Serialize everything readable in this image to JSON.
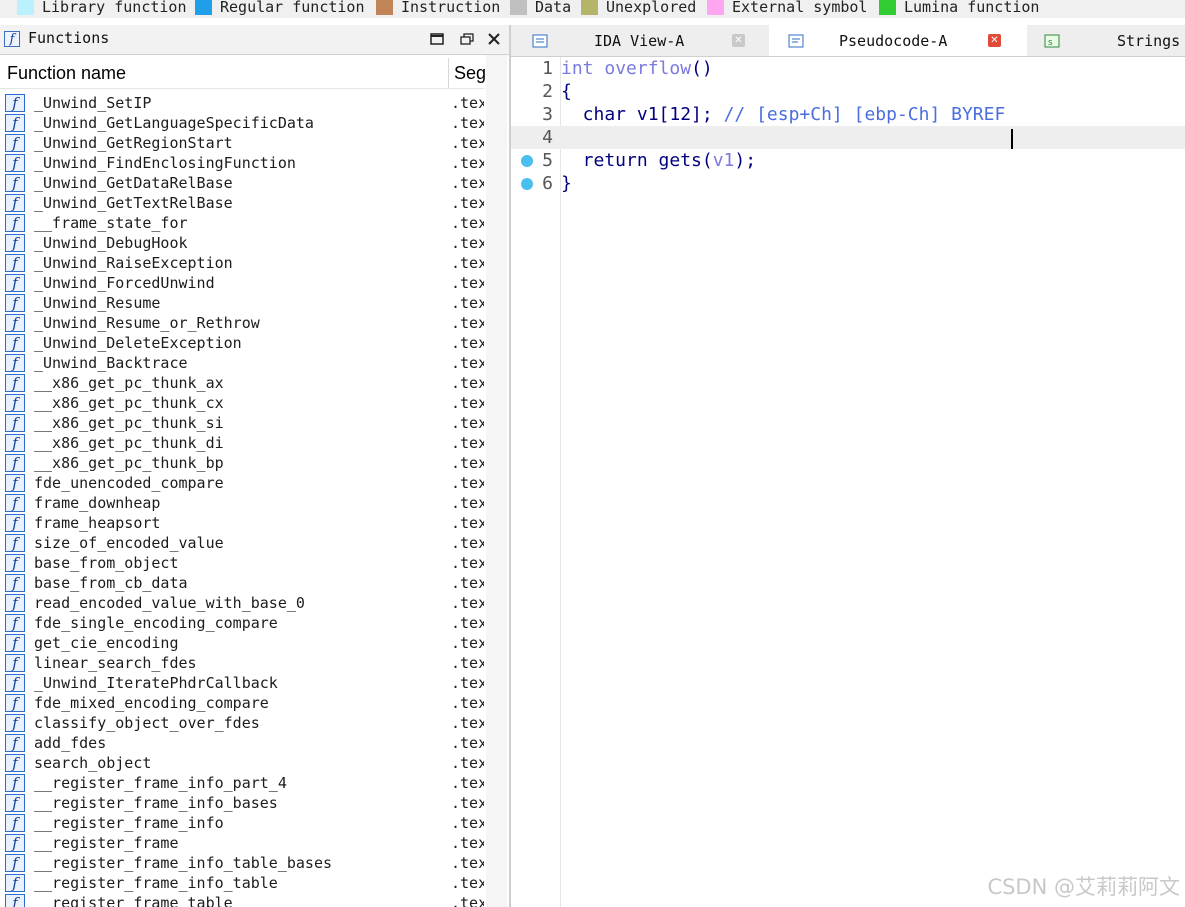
{
  "legend": [
    {
      "label": "Library function",
      "color": "#b9f1ff"
    },
    {
      "label": "Regular function",
      "color": "#1e9fe8"
    },
    {
      "label": "Instruction",
      "color": "#c08458"
    },
    {
      "label": "Data",
      "color": "#c0c0c0"
    },
    {
      "label": "Unexplored",
      "color": "#b5b56a"
    },
    {
      "label": "External symbol",
      "color": "#ffa6f0"
    },
    {
      "label": "Lumina function",
      "color": "#33cc33"
    }
  ],
  "functions_panel": {
    "title": "Functions",
    "col_name": "Function name",
    "col_segment": "Seg",
    "rows": [
      {
        "name": "_Unwind_SetIP",
        "seg": ".tex"
      },
      {
        "name": "_Unwind_GetLanguageSpecificData",
        "seg": ".tex"
      },
      {
        "name": "_Unwind_GetRegionStart",
        "seg": ".tex"
      },
      {
        "name": "_Unwind_FindEnclosingFunction",
        "seg": ".tex"
      },
      {
        "name": "_Unwind_GetDataRelBase",
        "seg": ".tex"
      },
      {
        "name": "_Unwind_GetTextRelBase",
        "seg": ".tex"
      },
      {
        "name": "__frame_state_for",
        "seg": ".tex"
      },
      {
        "name": "_Unwind_DebugHook",
        "seg": ".tex"
      },
      {
        "name": "_Unwind_RaiseException",
        "seg": ".tex"
      },
      {
        "name": "_Unwind_ForcedUnwind",
        "seg": ".tex"
      },
      {
        "name": "_Unwind_Resume",
        "seg": ".tex"
      },
      {
        "name": "_Unwind_Resume_or_Rethrow",
        "seg": ".tex"
      },
      {
        "name": "_Unwind_DeleteException",
        "seg": ".tex"
      },
      {
        "name": "_Unwind_Backtrace",
        "seg": ".tex"
      },
      {
        "name": "__x86_get_pc_thunk_ax",
        "seg": ".tex"
      },
      {
        "name": "__x86_get_pc_thunk_cx",
        "seg": ".tex"
      },
      {
        "name": "__x86_get_pc_thunk_si",
        "seg": ".tex"
      },
      {
        "name": "__x86_get_pc_thunk_di",
        "seg": ".tex"
      },
      {
        "name": "__x86_get_pc_thunk_bp",
        "seg": ".tex"
      },
      {
        "name": "fde_unencoded_compare",
        "seg": ".tex"
      },
      {
        "name": "frame_downheap",
        "seg": ".tex"
      },
      {
        "name": "frame_heapsort",
        "seg": ".tex"
      },
      {
        "name": "size_of_encoded_value",
        "seg": ".tex"
      },
      {
        "name": "base_from_object",
        "seg": ".tex"
      },
      {
        "name": "base_from_cb_data",
        "seg": ".tex"
      },
      {
        "name": "read_encoded_value_with_base_0",
        "seg": ".tex"
      },
      {
        "name": "fde_single_encoding_compare",
        "seg": ".tex"
      },
      {
        "name": "get_cie_encoding",
        "seg": ".tex"
      },
      {
        "name": "linear_search_fdes",
        "seg": ".tex"
      },
      {
        "name": "_Unwind_IteratePhdrCallback",
        "seg": ".tex"
      },
      {
        "name": "fde_mixed_encoding_compare",
        "seg": ".tex"
      },
      {
        "name": "classify_object_over_fdes",
        "seg": ".tex"
      },
      {
        "name": "add_fdes",
        "seg": ".tex"
      },
      {
        "name": "search_object",
        "seg": ".tex"
      },
      {
        "name": "__register_frame_info_part_4",
        "seg": ".tex"
      },
      {
        "name": "__register_frame_info_bases",
        "seg": ".tex"
      },
      {
        "name": "__register_frame_info",
        "seg": ".tex"
      },
      {
        "name": "__register_frame",
        "seg": ".tex"
      },
      {
        "name": "__register_frame_info_table_bases",
        "seg": ".tex"
      },
      {
        "name": "__register_frame_info_table",
        "seg": ".tex"
      },
      {
        "name": "__register_frame_table",
        "seg": ".tex"
      }
    ]
  },
  "tabs": [
    {
      "label": "IDA View-A",
      "active": false
    },
    {
      "label": "Pseudocode-A",
      "active": true
    },
    {
      "label": "Strings",
      "active": false
    }
  ],
  "code": {
    "lines": [
      {
        "no": "1",
        "tokens": [
          {
            "t": "int ",
            "c": "k-fn"
          },
          {
            "t": "overflow",
            "c": "k-fn"
          },
          {
            "t": "()",
            "c": "k-kw"
          }
        ]
      },
      {
        "no": "2",
        "tokens": [
          {
            "t": "{",
            "c": "k-kw"
          }
        ]
      },
      {
        "no": "3",
        "tokens": [
          {
            "t": "  char v1[12]; ",
            "c": "k-kw"
          },
          {
            "t": "// [esp+Ch] [ebp-Ch] BYREF",
            "c": "k-cm"
          }
        ]
      },
      {
        "no": "4",
        "tokens": []
      },
      {
        "no": "5",
        "tokens": [
          {
            "t": "  return gets(",
            "c": "k-kw"
          },
          {
            "t": "v1",
            "c": "k-fn"
          },
          {
            "t": ");",
            "c": "k-kw"
          }
        ]
      },
      {
        "no": "6",
        "tokens": [
          {
            "t": "}",
            "c": "k-kw"
          }
        ]
      }
    ]
  },
  "watermark": "CSDN @艾莉莉阿文"
}
